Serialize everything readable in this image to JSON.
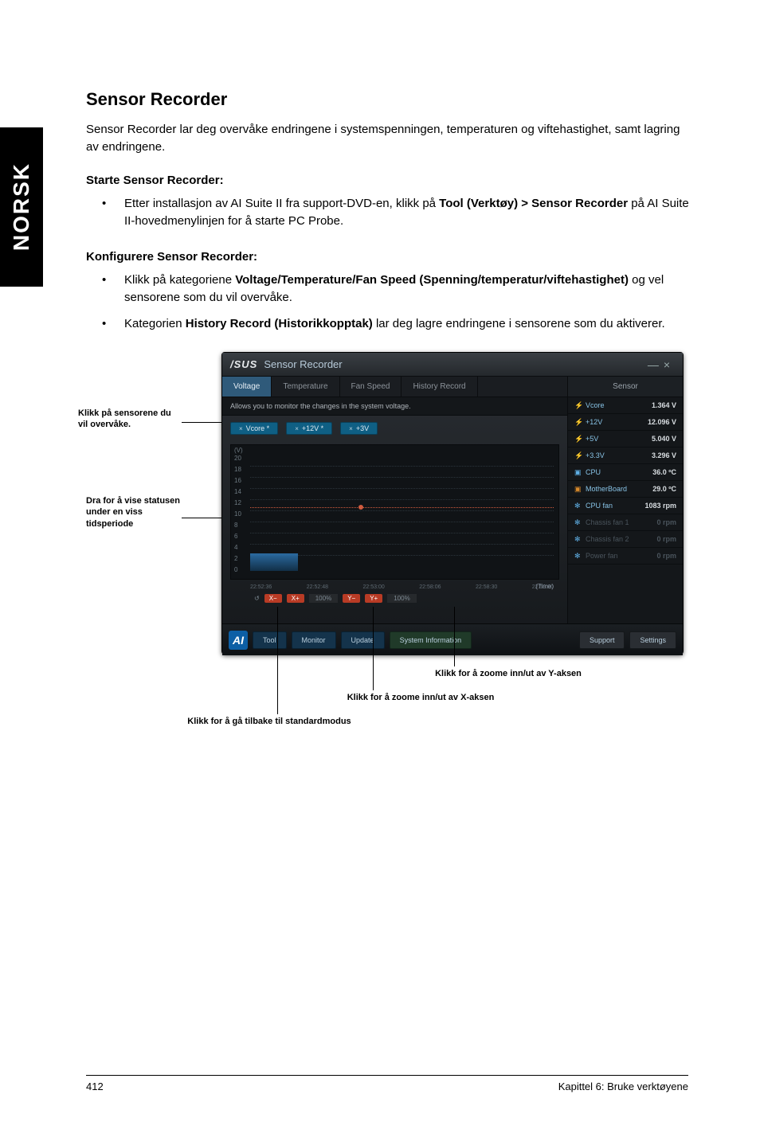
{
  "side_tab": "NORSK",
  "heading": "Sensor Recorder",
  "intro": "Sensor Recorder lar deg overvåke endringene i systemspenningen, temperaturen og viftehastighet, samt lagring av endringene.",
  "start_heading": "Starte Sensor Recorder:",
  "start_bullet_pre": "Etter installasjon av AI Suite II fra support-DVD-en, klikk på ",
  "start_bullet_bold": "Tool (Verktøy) > Sensor Recorder",
  "start_bullet_post": " på AI Suite II-hovedmenylinjen for å starte PC Probe.",
  "config_heading": "Konfigurere Sensor Recorder:",
  "config_b1_pre": "Klikk på kategoriene ",
  "config_b1_bold": "Voltage/Temperature/Fan Speed (Spenning/temperatur/viftehastighet)",
  "config_b1_post": " og vel sensorene som du vil overvåke.",
  "config_b2_pre": "Kategorien ",
  "config_b2_bold": "History Record (Historikkopptak)",
  "config_b2_post": " lar deg lagre endringene i sensorene som du aktiverer.",
  "callouts": {
    "sensors": "Klikk på sensorene du vil overvåke.",
    "drag": "Dra for å vise statusen under en viss tidsperiode",
    "zoom_y": "Klikk for å zoome inn/ut av Y-aksen",
    "zoom_x": "Klikk for å zoome inn/ut av X-aksen",
    "default": "Klikk for å gå tilbake til standardmodus"
  },
  "app": {
    "brand": "/SUS",
    "title": "Sensor Recorder",
    "win_min": "—",
    "win_close": "×",
    "tabs": {
      "voltage": "Voltage",
      "temperature": "Temperature",
      "fanspeed": "Fan Speed",
      "history": "History Record"
    },
    "desc": "Allows you to monitor the changes in the system voltage.",
    "chips": {
      "vcore": "Vcore *",
      "p12v": "+12V *",
      "p3v": "+3V"
    },
    "chip_close": "×",
    "yaxis_label": "(V)",
    "yticks": [
      "20",
      "18",
      "16",
      "14",
      "12",
      "10",
      "8",
      "6",
      "4",
      "2",
      "0"
    ],
    "xticks": [
      "22:52:36",
      "22:52:48",
      "22:53:00",
      "22:58:06",
      "22:58:30",
      "22:59:00"
    ],
    "time_label": "(Time)",
    "zoom": {
      "reset_icon": "↺",
      "xminus": "X−",
      "xplus": "X+",
      "xpct": "100%",
      "yminus": "Y−",
      "yplus": "Y+",
      "ypct": "100%"
    },
    "right_head": "Sensor",
    "sensors": [
      {
        "icon": "⚡",
        "iclass": "ic-bolt",
        "name": "Vcore",
        "value": "1.364 V"
      },
      {
        "icon": "⚡",
        "iclass": "ic-bolt",
        "name": "+12V",
        "value": "12.096 V"
      },
      {
        "icon": "⚡",
        "iclass": "ic-bolt",
        "name": "+5V",
        "value": "5.040 V"
      },
      {
        "icon": "⚡",
        "iclass": "ic-bolt",
        "name": "+3.3V",
        "value": "3.296 V"
      },
      {
        "icon": "▣",
        "iclass": "ic-cpu",
        "name": "CPU",
        "value": "36.0 ºC"
      },
      {
        "icon": "▣",
        "iclass": "ic-mb",
        "name": "MotherBoard",
        "value": "29.0 ºC"
      },
      {
        "icon": "✻",
        "iclass": "ic-fan",
        "name": "CPU fan",
        "value": "1083 rpm"
      },
      {
        "icon": "✻",
        "iclass": "ic-fan",
        "name": "Chassis fan 1",
        "value": "0 rpm",
        "dim": true
      },
      {
        "icon": "✻",
        "iclass": "ic-fan",
        "name": "Chassis fan 2",
        "value": "0 rpm",
        "dim": true
      },
      {
        "icon": "✻",
        "iclass": "ic-fan",
        "name": "Power fan",
        "value": "0 rpm",
        "dim": true
      }
    ],
    "bottom": {
      "logo": "AI",
      "tool": "Tool",
      "monitor": "Monitor",
      "update": "Update",
      "sysinfo": "System Information",
      "support": "Support",
      "settings": "Settings"
    }
  },
  "chart_data": {
    "type": "line",
    "title": "Voltage",
    "xlabel": "(Time)",
    "ylabel": "(V)",
    "ylim": [
      0,
      20
    ],
    "x": [
      "22:52:36",
      "22:52:48",
      "22:53:00",
      "22:58:06",
      "22:58:30",
      "22:59:00"
    ],
    "series": [
      {
        "name": "Vcore",
        "values": [
          1.36,
          1.36,
          1.36,
          1.36,
          1.36,
          1.36
        ]
      },
      {
        "name": "+12V",
        "values": [
          12.1,
          12.1,
          12.1,
          12.1,
          12.1,
          12.1
        ]
      },
      {
        "name": "+3V",
        "values": [
          3.3,
          3.3,
          3.3,
          3.3,
          3.3,
          3.3
        ]
      }
    ]
  },
  "footer": {
    "page": "412",
    "chapter": "Kapittel 6: Bruke verktøyene"
  }
}
